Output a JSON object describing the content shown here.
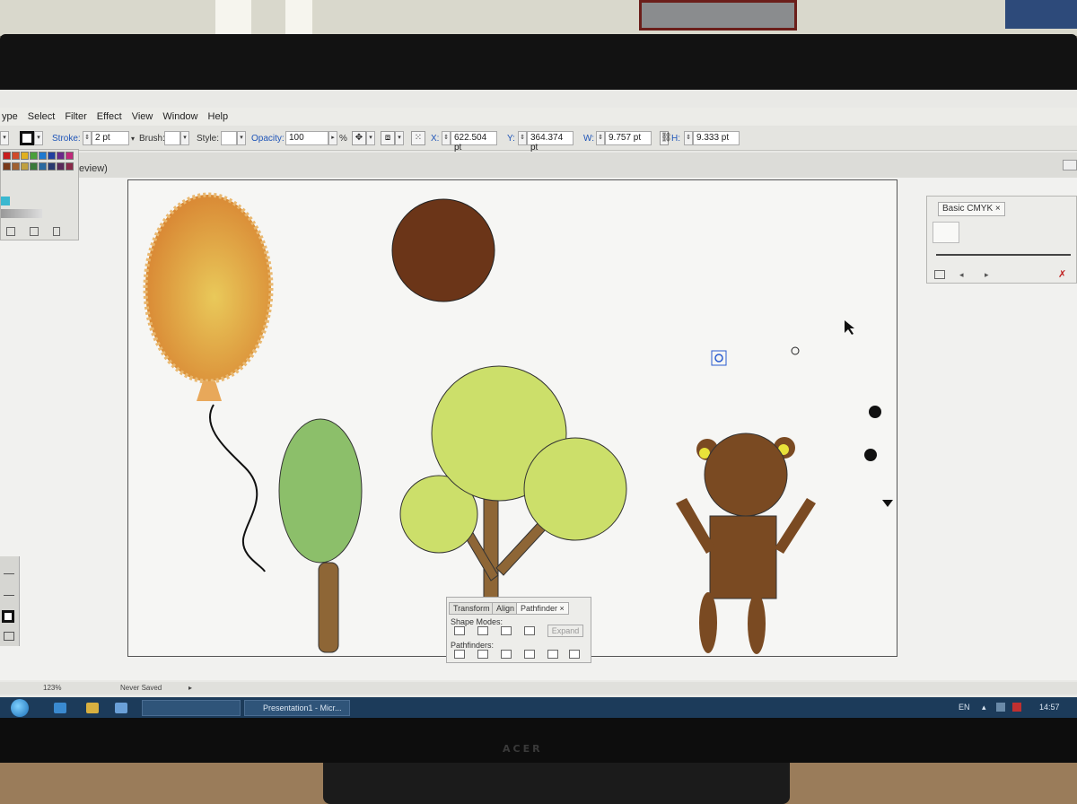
{
  "menu": [
    "ype",
    "Select",
    "Filter",
    "Effect",
    "View",
    "Window",
    "Help"
  ],
  "control": {
    "stroke_label": "Stroke:",
    "stroke_value": "2 pt",
    "brush_label": "Brush:",
    "style_label": "Style:",
    "opacity_label": "Opacity:",
    "opacity_value": "100",
    "percent": "%",
    "x_label": "X:",
    "x_value": "622.504 pt",
    "y_label": "Y:",
    "y_value": "364.374 pt",
    "w_label": "W:",
    "w_value": "9.757 pt",
    "h_label": "H:",
    "h_value": "9.333 pt"
  },
  "document": {
    "tab_label": "/Preview)"
  },
  "swatch_colors": [
    "#c81e1e",
    "#d04a2a",
    "#e0b020",
    "#4aa03a",
    "#1e7ad0",
    "#2040a0",
    "#6a2a8a",
    "#c02a7a",
    "#7a3a1a",
    "#a06030",
    "#c0a040",
    "#3a7a3a",
    "#2a6aa0",
    "#2a3a70",
    "#5a2a5a",
    "#8a2a4a"
  ],
  "panels": {
    "cmyk_tab": "Basic CMYK",
    "pathfinder": {
      "tabs": [
        "Transform",
        "Align",
        "Pathfinder"
      ],
      "shape_modes": "Shape Modes:",
      "expand": "Expand",
      "pathfinders": "Pathfinders:"
    }
  },
  "status": {
    "zoom": "123%",
    "save_state": "Never Saved"
  },
  "taskbar": {
    "items": [
      "",
      "Presentation1 - Micr..."
    ],
    "language": "EN",
    "clock": "14:57"
  },
  "colors": {
    "balloon": "#e0923a",
    "dark_ball": "#6b3518",
    "tree_green": "#8cbf6a",
    "tree_yellow_green": "#ccdf6a",
    "trunk": "#8e6636",
    "bear": "#7a4a22"
  },
  "monitor_brand": "ACER"
}
